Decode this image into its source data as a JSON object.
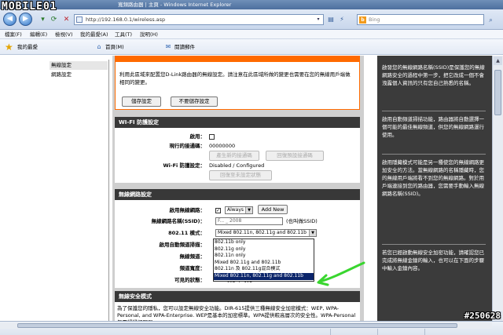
{
  "window": {
    "title": "寬頻路由器 | 主頁 - Windows Internet Explorer",
    "watermark": "MOBILE01"
  },
  "address_bar": {
    "url": "http://192.168.0.1/wireless.asp",
    "search_placeholder": "Bing",
    "search_engine": "b"
  },
  "menu": [
    "檔案(F)",
    "編輯(E)",
    "檢視(V)",
    "我的最愛(A)",
    "工具(T)",
    "說明(H)"
  ],
  "favorites_bar": {
    "favorites_label": "我的最愛",
    "home_label": "首頁(M)",
    "mail_label": "閱讀郵件"
  },
  "left_nav": [
    "無線設定",
    "網路設定"
  ],
  "top_section": {
    "description": "利用此區域來配置您D-Link路由器的無線設定。請注意在此區域所做的變更也需要在您的無線用戶端做相同的變更。",
    "save_label": "儲存設定",
    "dont_save_label": "不要儲存設定"
  },
  "wifi_protected": {
    "heading": "WI-FI 防護設定",
    "enable_label": "啟用：",
    "pin_label": "現行的接通碼：",
    "pin_value": "00000000",
    "generate_pin_label": "產生新的接通碼",
    "reset_pin_label": "回復預設接通碼",
    "status_label": "Wi-Fi 防護設定：",
    "status_value": "Disabled / Configured",
    "reset_unconfigured_label": "回復至未設定狀態"
  },
  "wireless_network": {
    "heading": "無線網路設定",
    "enable_label": "啟用無線網路：",
    "schedule_value": "Always",
    "add_new_label": "Add New",
    "ssid_label": "無線網路名稱(SSID)：",
    "ssid_value": "F... _ 2008",
    "ssid_note": "(也叫做SSID)",
    "mode_label": "802.11 模式：",
    "mode_value": "Mixed 802.11n, 802.11g and 802.11b",
    "auto_channel_label": "啟用自動頻道掃描：",
    "channel_label": "無線頻道：",
    "channel_width_label": "頻道寬度：",
    "visibility_label": "可見的狀態：",
    "visibility_value": "可見   不可見",
    "mode_options": [
      "802.11b only",
      "802.11g only",
      "802.11n only",
      "Mixed 802.11g and 802.11b",
      "802.11n 及 802.11g混合模式",
      "Mixed 802.11n, 802.11g and 802.11b"
    ]
  },
  "wireless_security": {
    "heading": "無線安全模式",
    "text": "為了保護您的隱私，您可以設定無線安全功能。DIR-615提供三種無線安全加密模式：WEP, WPA-Personal, and WPA-Enterprise. WEP是基本的加密標準。WPA提供較高層次的安全性。WPA-Personal 無需認證伺服器..."
  },
  "right_panel": [
    "啟發您的無線網路名稱(SSID)是保護您的無線網路安全的過程中第一步，把它改成一個不會洩露個人資訊的只有您自己熟悉的名稱。",
    "啟用自動頻道掃描功能，路由器將自動選擇一個可能的最佳無線頻道，供您的無線網路運行使用。",
    "啟用隱藏模式可能是另一種使您的無線網路更加安全的方法。當無線網路的名稱隱藏時，您的無線用戶端將看不到您的無線網路。對於用戶端連接到您的路由器，您需要手動輸入無線網路名稱(SSID)。",
    "若您已經啟動無線安全加密功能，請確認您已完成將無線金鑰的輸入，也可以在下面的步驟中輸入金鑰內容。"
  ],
  "status_tag": "#250628"
}
